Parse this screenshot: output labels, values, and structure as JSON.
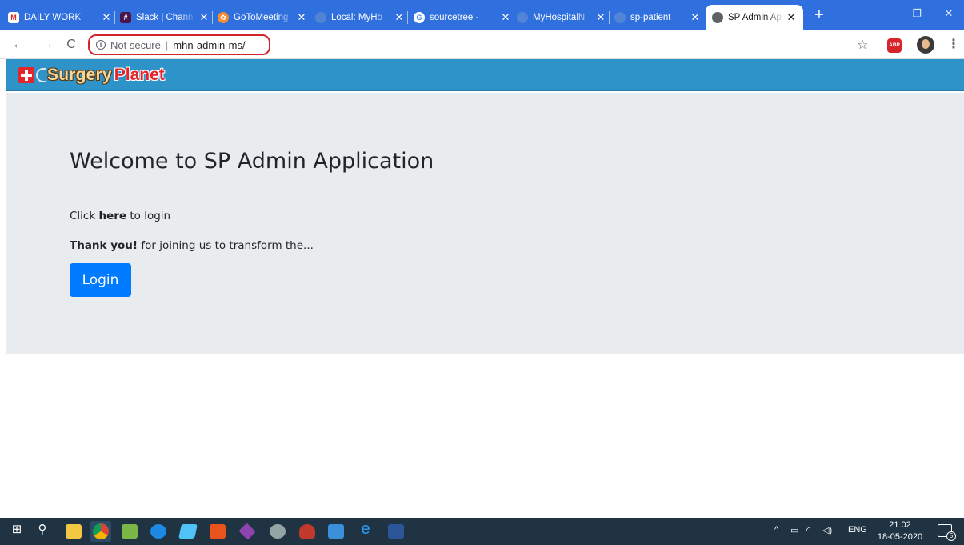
{
  "browser": {
    "tabs": [
      {
        "label": "DAILY WORK",
        "icon": "gmail-icon",
        "color": "#d93025"
      },
      {
        "label": "Slack | Chann",
        "icon": "slack-icon",
        "color": "#4a154b"
      },
      {
        "label": "GoToMeeting",
        "icon": "gotomeeting-icon",
        "color": "#f68d2e"
      },
      {
        "label": "Local: MyHo",
        "icon": "globe-icon",
        "color": "#5f8dd3"
      },
      {
        "label": "sourcetree -",
        "icon": "google-icon",
        "color": "#ffffff"
      },
      {
        "label": "MyHospitalN",
        "icon": "globe-icon",
        "color": "#5f8dd3"
      },
      {
        "label": "sp-patient",
        "icon": "globe-icon",
        "color": "#5f8dd3"
      },
      {
        "label": "SP Admin Ap",
        "icon": "globe-icon",
        "color": "#5f6368",
        "active": true
      }
    ],
    "omnibox": {
      "security": "Not secure",
      "url": "mhn-admin-ms/"
    },
    "abp_label": "ABP",
    "colors": {
      "tabstrip": "#2f70de",
      "highlight": "#d0262c"
    }
  },
  "site": {
    "logo": {
      "word1": "Surgery",
      "word2": "Planet"
    },
    "header_color": "#2e93c9"
  },
  "jumbotron": {
    "title": "Welcome to SP Admin Application",
    "line1_prefix": "Click ",
    "line1_bold": "here",
    "line1_suffix": " to login",
    "line2_bold": "Thank you!",
    "line2_suffix": " for joining us to transform the...",
    "login_label": "Login",
    "button_color": "#007bff"
  },
  "taskbar": {
    "language": "ENG",
    "time": "21:02",
    "date": "18-05-2020",
    "notifications": "5"
  }
}
